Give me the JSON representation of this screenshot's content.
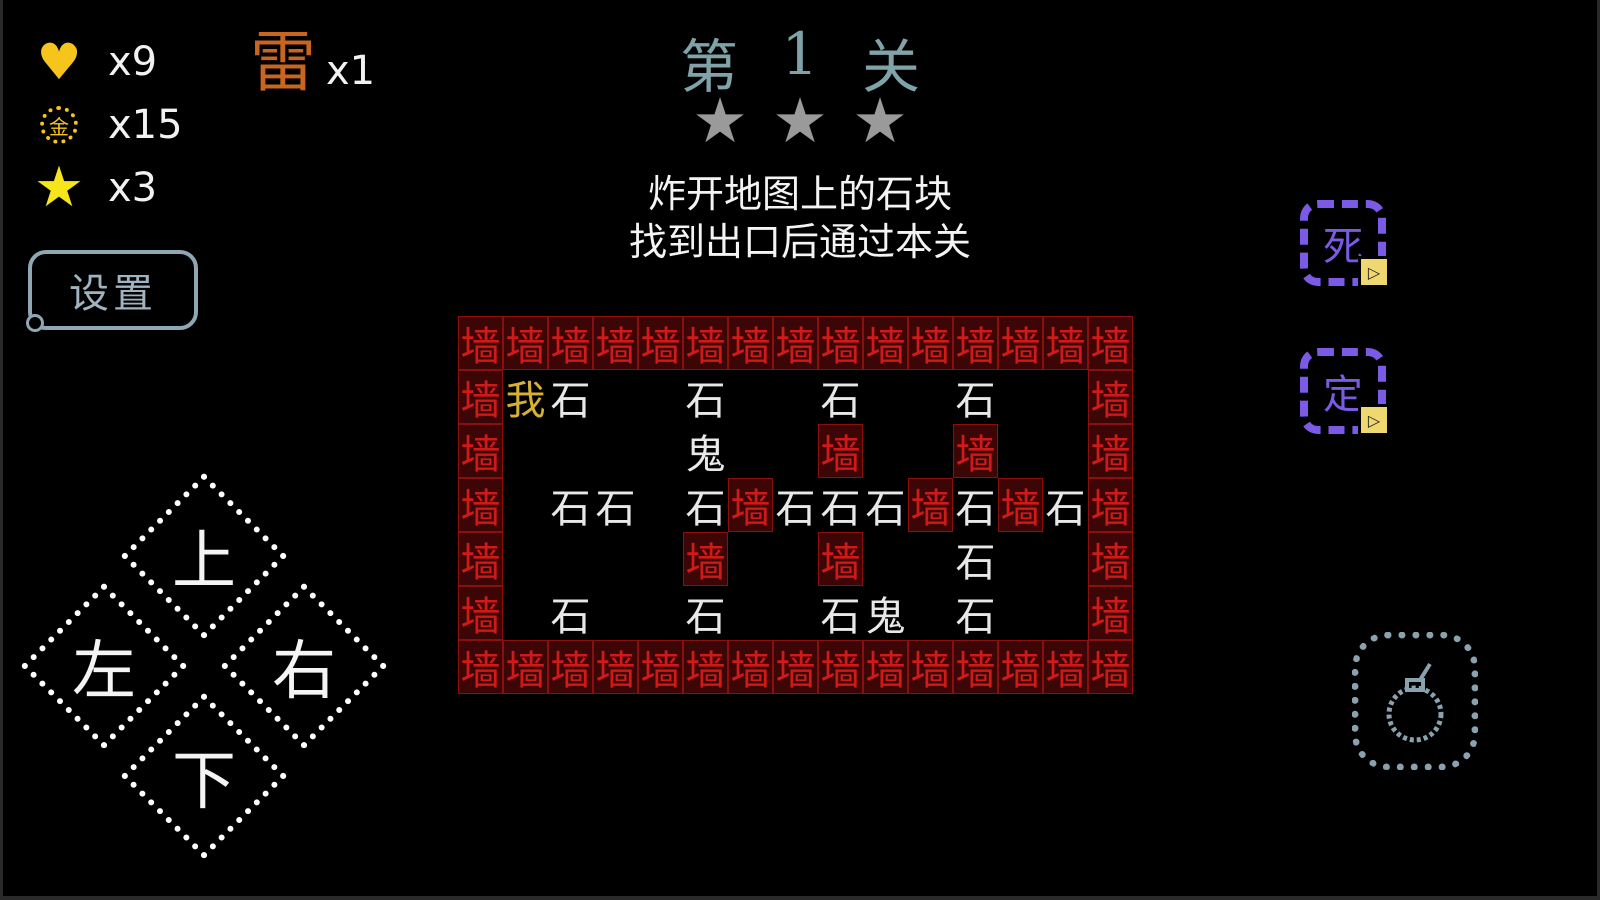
{
  "hud": {
    "lives": "x9",
    "coins": "x15",
    "stars": "x3",
    "mines_glyph": "雷",
    "mines": "x1",
    "coin_glyph": "金",
    "settings_label": "设置"
  },
  "level": {
    "title_chars": [
      "第",
      "1",
      "关"
    ],
    "stars_earned": 0,
    "stars_total": 3,
    "objective_line1": "炸开地图上的石块",
    "objective_line2": "找到出口后通过本关"
  },
  "board": {
    "legend": {
      "W": "墙",
      "S": "石",
      "G": "鬼",
      "P": "我",
      ".": ""
    },
    "rows": [
      "WWWWWWWWWWWWWWW",
      "WPS..S..S..S..W",
      "W....G..W..W..W",
      "W.SS.SWSSSWSWSW",
      "W....W..W..S..W",
      "W.S..S..SG.S..W",
      "WWWWWWWWWWWWWWW"
    ]
  },
  "dpad": {
    "up": "上",
    "down": "下",
    "left": "左",
    "right": "右"
  },
  "skills": [
    {
      "glyph": "死",
      "icon": "play-icon"
    },
    {
      "glyph": "定",
      "icon": "play-icon"
    }
  ],
  "bomb_icon": "bomb-icon",
  "colors": {
    "wall": "#d01919",
    "player": "#d6b234",
    "gold": "#f6c51b",
    "skill": "#7b5ae6",
    "title": "#7fa3a8"
  }
}
